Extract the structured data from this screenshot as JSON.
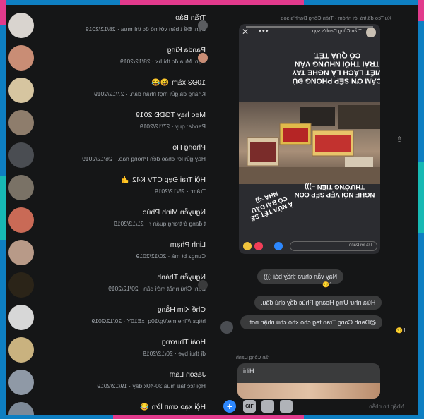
{
  "conversations": [
    {
      "name": "Trần Bảo",
      "preview": "Bạn: Để t bàn với nó đc thì mua",
      "date": "28/12/2019",
      "avatar_color": "#d9d4cf"
    },
    {
      "name": "Panda King",
      "preview": "Bạn: Mua đc thì hk",
      "date": "28/12/2019",
      "avatar_color": "#c98d75"
    },
    {
      "name": "10Đ3 xàm",
      "preview": "Khang đã gửi một nhãn dán.",
      "date": "27/12/2019",
      "emoji": "😆😂",
      "avatar_color": "#d6c5a0"
    },
    {
      "name": "Meo hay TGDĐ 2019",
      "preview": "Panda: quy",
      "date": "27/12/2019",
      "avatar_color": "#8e7d6c"
    },
    {
      "name": "Phong Ho",
      "preview": "Hãy gửi lời chào đến Phong nào.",
      "date": "26/12/2019",
      "avatar_color": "#4a4d52"
    },
    {
      "name": "Hội Trai Đẹp CTV K42",
      "preview": "Trâm:",
      "date": "25/12/2019",
      "emoji": "👍",
      "avatar_color": "#7a7266"
    },
    {
      "name": "Nguyễn Minh Phúc",
      "preview": "t đang ở trong quán r",
      "date": "21/12/2019",
      "avatar_color": "#c96a56"
    },
    {
      "name": "Linh Phạm",
      "preview": "Cungz bt mà",
      "date": "20/12/2019",
      "avatar_color": "#b89a88"
    },
    {
      "name": "Nguyễn Thành",
      "preview": "Bạn: Chú nhắt mới bẩn",
      "date": "20/12/2019",
      "avatar_color": "#2b2418"
    },
    {
      "name": "Chế Kim Hằng",
      "preview": "https://fine.me/t/g/10q_xE10Y",
      "date": "20/12/2019",
      "avatar_color": "#d7d7d7"
    },
    {
      "name": "Hoài Thương",
      "preview": "đị thui bye",
      "date": "20/12/2019",
      "avatar_color": "#c9b27f"
    },
    {
      "name": "Jason Lam",
      "preview": "Hội tcc tau mua 30-40k dây",
      "date": "19/12/2019",
      "avatar_color": "#8f99a6"
    },
    {
      "name": "Hội xạo cmn lờn",
      "preview": "",
      "date": "",
      "emoji": "😂",
      "avatar_color": "#7e8a98"
    }
  ],
  "chat": {
    "header": "Xu Teo đã trả lời nhóm · Trần Công Danh's sọp",
    "story": {
      "user": "Trần Công Danh's sọp",
      "text_top": "Cảm ơn sếp Phong đủ viết lách là nghe tay trái thôi nhưng vẫn có quà Tết.",
      "text_middle": "Nghe nói vẹp sếp còn thưởng tiền =)))",
      "text_bottom": "À nửa Tết sẽ có bài đầu nha =))",
      "reply_placeholder": "Trả lời Danh"
    },
    "messages": [
      {
        "text": "Nay vẫn chưa thấy bài :)))",
        "emoji": "😏",
        "count": "1"
      },
      {
        "text": "Hứa như Ưng Hoàng Phúc đẩy chủ đâu.",
        "emoji": "",
        "count": ""
      },
      {
        "text": "@Danh Cong Tran tag cho khỏ chủ nhận noti.",
        "emoji": "😏",
        "count": "1"
      }
    ],
    "sender_label": "Trần Công Danh",
    "last_message": "Hihi",
    "composer_placeholder": "Nhập tin nhắn..."
  },
  "composer": {
    "plus_label": "+",
    "gif_label": "GIF"
  },
  "colors": {
    "background": "#151617",
    "accent": "#2d88ff",
    "frame_pink": "#e23a8c",
    "frame_blue": "#0e7fc2",
    "frame_green": "#17b9b4"
  },
  "icons": [
    "close-icon",
    "more-icon",
    "share-icon",
    "plus-icon",
    "gif-icon",
    "sticker-icon",
    "photo-icon",
    "like-reaction-icon",
    "love-reaction-icon"
  ]
}
